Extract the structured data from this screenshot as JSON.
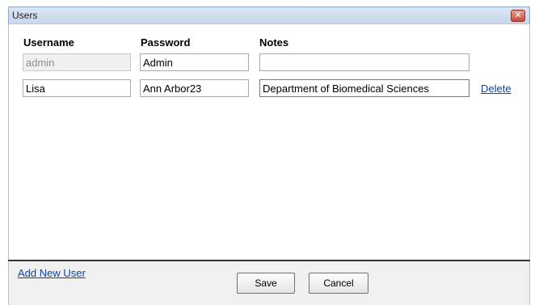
{
  "window": {
    "title": "Users",
    "close_icon": "close-icon"
  },
  "columns": {
    "username": "Username",
    "password": "Password",
    "notes": "Notes"
  },
  "users": [
    {
      "username": "admin",
      "password": "Admin",
      "notes": "",
      "username_disabled": true,
      "delete_label": ""
    },
    {
      "username": "Lisa",
      "password": "Ann Arbor23",
      "notes": "Department of Biomedical Sciences",
      "username_disabled": false,
      "delete_label": "Delete"
    }
  ],
  "footer": {
    "add_user_label": "Add New User",
    "save_label": "Save",
    "cancel_label": "Cancel"
  }
}
